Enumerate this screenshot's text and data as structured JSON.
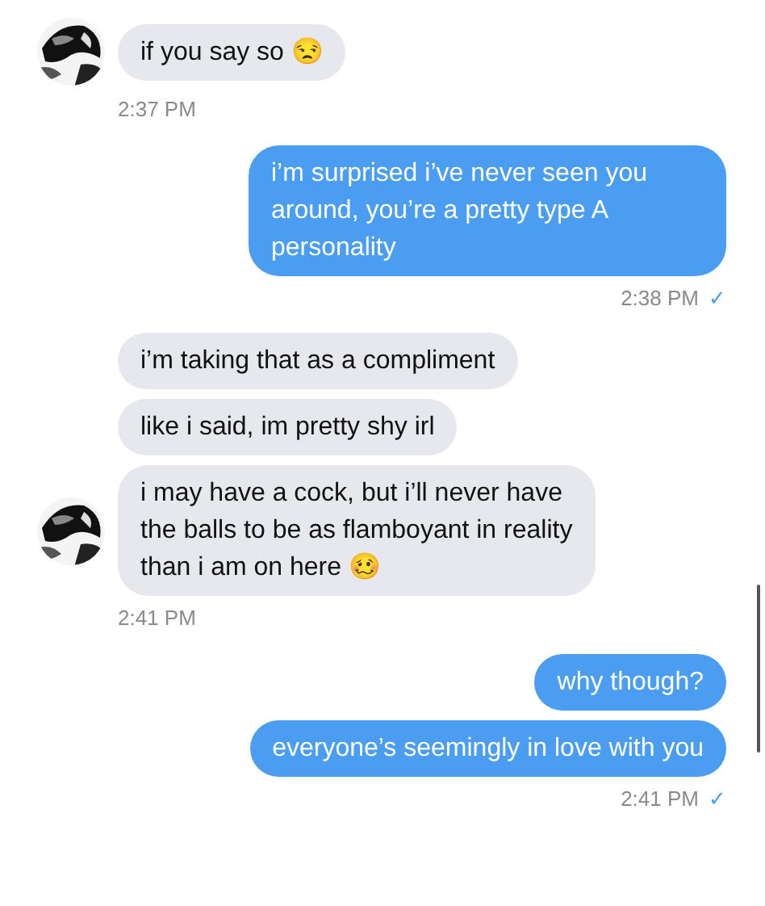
{
  "messages": [
    {
      "kind": "incoming",
      "bubbles": [
        "if you say so 😒"
      ],
      "time": "2:37 PM"
    },
    {
      "kind": "outgoing",
      "bubbles": [
        "i’m surprised i’ve never seen you around, you’re a pretty type A personality"
      ],
      "time": "2:38 PM",
      "receipt": "✓"
    },
    {
      "kind": "incoming",
      "bubbles": [
        "i’m taking that as a compliment",
        "like i said, im pretty shy irl",
        "i may have a cock, but i’ll never have the balls to be as flamboyant in reality than i am on here 🥴"
      ],
      "time": "2:41 PM"
    },
    {
      "kind": "outgoing",
      "bubbles": [
        "why though?",
        "everyone’s seemingly in love with you"
      ],
      "time": "2:41 PM",
      "receipt": "✓"
    }
  ]
}
